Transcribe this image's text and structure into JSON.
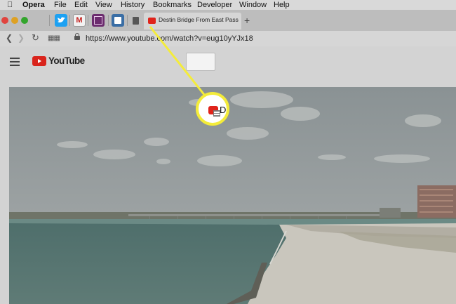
{
  "menubar": {
    "app_name": "Opera",
    "items": [
      "File",
      "Edit",
      "View",
      "History",
      "Bookmarks",
      "Developer",
      "Window",
      "Help"
    ]
  },
  "tabs": {
    "active_title": "Destin Bridge From East Pass Th",
    "new_tab_symbol": "+"
  },
  "address": {
    "url": "https://www.youtube.com/watch?v=eug10yYJx18"
  },
  "youtube": {
    "logo_text": "YouTube"
  },
  "callout": {
    "letter": "D",
    "ring_color": "#f4ec3a"
  },
  "colors": {
    "close": "#e0443e",
    "minimize": "#dea123",
    "maximize": "#33a52c",
    "youtube_red": "#d9241c"
  }
}
